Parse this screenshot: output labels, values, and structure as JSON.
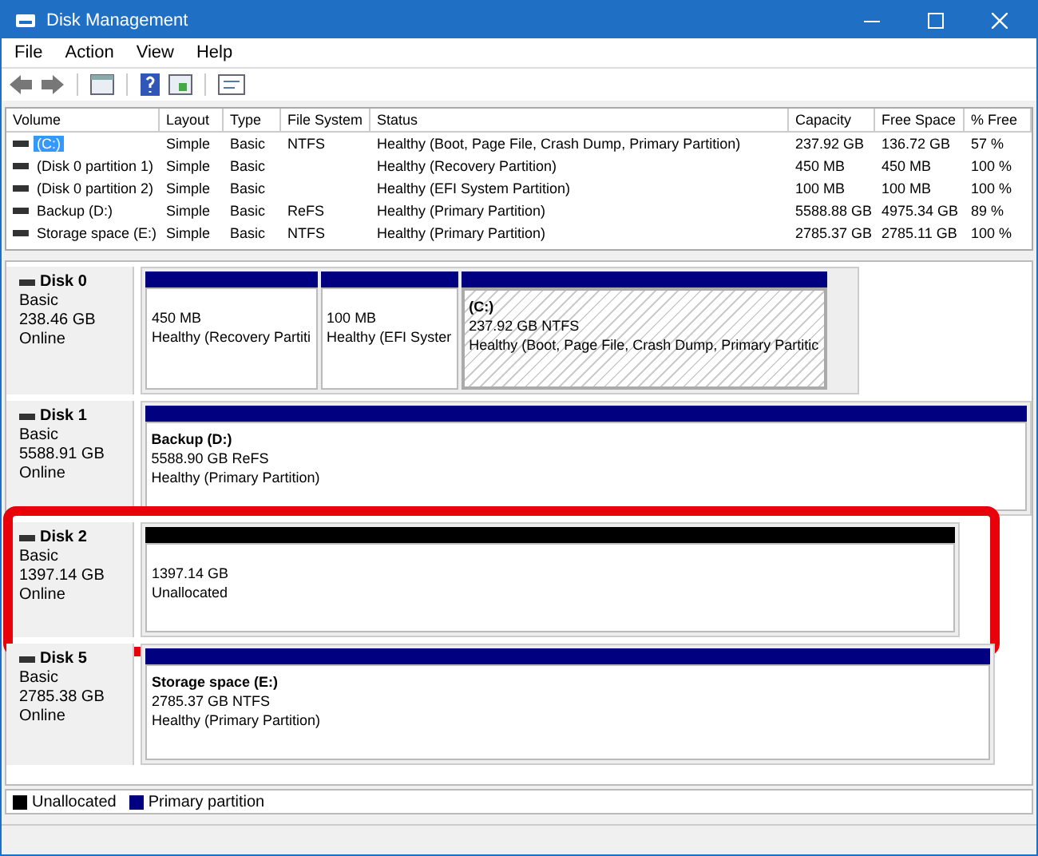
{
  "window": {
    "title": "Disk Management"
  },
  "menu": [
    "File",
    "Action",
    "View",
    "Help"
  ],
  "table": {
    "columns": [
      "Volume",
      "Layout",
      "Type",
      "File System",
      "Status",
      "Capacity",
      "Free Space",
      "% Free"
    ],
    "rows": [
      {
        "selected": true,
        "cells": [
          "(C:)",
          "Simple",
          "Basic",
          "NTFS",
          "Healthy (Boot, Page File, Crash Dump, Primary Partition)",
          "237.92 GB",
          "136.72 GB",
          "57 %"
        ]
      },
      {
        "selected": false,
        "cells": [
          "(Disk 0 partition 1)",
          "Simple",
          "Basic",
          "",
          "Healthy (Recovery Partition)",
          "450 MB",
          "450 MB",
          "100 %"
        ]
      },
      {
        "selected": false,
        "cells": [
          "(Disk 0 partition 2)",
          "Simple",
          "Basic",
          "",
          "Healthy (EFI System Partition)",
          "100 MB",
          "100 MB",
          "100 %"
        ]
      },
      {
        "selected": false,
        "cells": [
          "Backup (D:)",
          "Simple",
          "Basic",
          "ReFS",
          "Healthy (Primary Partition)",
          "5588.88 GB",
          "4975.34 GB",
          "89 %"
        ]
      },
      {
        "selected": false,
        "cells": [
          "Storage space (E:)",
          "Simple",
          "Basic",
          "NTFS",
          "Healthy (Primary Partition)",
          "2785.37 GB",
          "2785.11 GB",
          "100 %"
        ]
      }
    ]
  },
  "disks": [
    {
      "name": "Disk 0",
      "type": "Basic",
      "size": "238.46 GB",
      "state": "Online",
      "highlighted": false,
      "partitions": [
        {
          "kind": "primary",
          "selected": false,
          "size": "450 MB",
          "status": "Healthy (Recovery Partiti"
        },
        {
          "kind": "primary",
          "selected": false,
          "size": "100 MB",
          "status": "Healthy (EFI Syster"
        },
        {
          "kind": "primary",
          "selected": true,
          "name": "(C:)",
          "size": "237.92 GB NTFS",
          "status": "Healthy (Boot, Page File, Crash Dump, Primary Partitic"
        }
      ]
    },
    {
      "name": "Disk 1",
      "type": "Basic",
      "size": "5588.91 GB",
      "state": "Online",
      "highlighted": false,
      "partitions": [
        {
          "kind": "primary",
          "selected": false,
          "name": "Backup  (D:)",
          "size": "5588.90 GB ReFS",
          "status": "Healthy (Primary Partition)"
        }
      ]
    },
    {
      "name": "Disk 2",
      "type": "Basic",
      "size": "1397.14 GB",
      "state": "Online",
      "highlighted": true,
      "partitions": [
        {
          "kind": "unallocated",
          "selected": false,
          "size": "1397.14 GB",
          "status": "Unallocated"
        }
      ]
    },
    {
      "name": "Disk 5",
      "type": "Basic",
      "size": "2785.38 GB",
      "state": "Online",
      "highlighted": false,
      "partitions": [
        {
          "kind": "primary",
          "selected": false,
          "name": "Storage space  (E:)",
          "size": "2785.37 GB NTFS",
          "status": "Healthy (Primary Partition)"
        }
      ]
    }
  ],
  "legend": [
    {
      "label": "Unallocated",
      "color": "#000000"
    },
    {
      "label": "Primary partition",
      "color": "#000080"
    }
  ]
}
